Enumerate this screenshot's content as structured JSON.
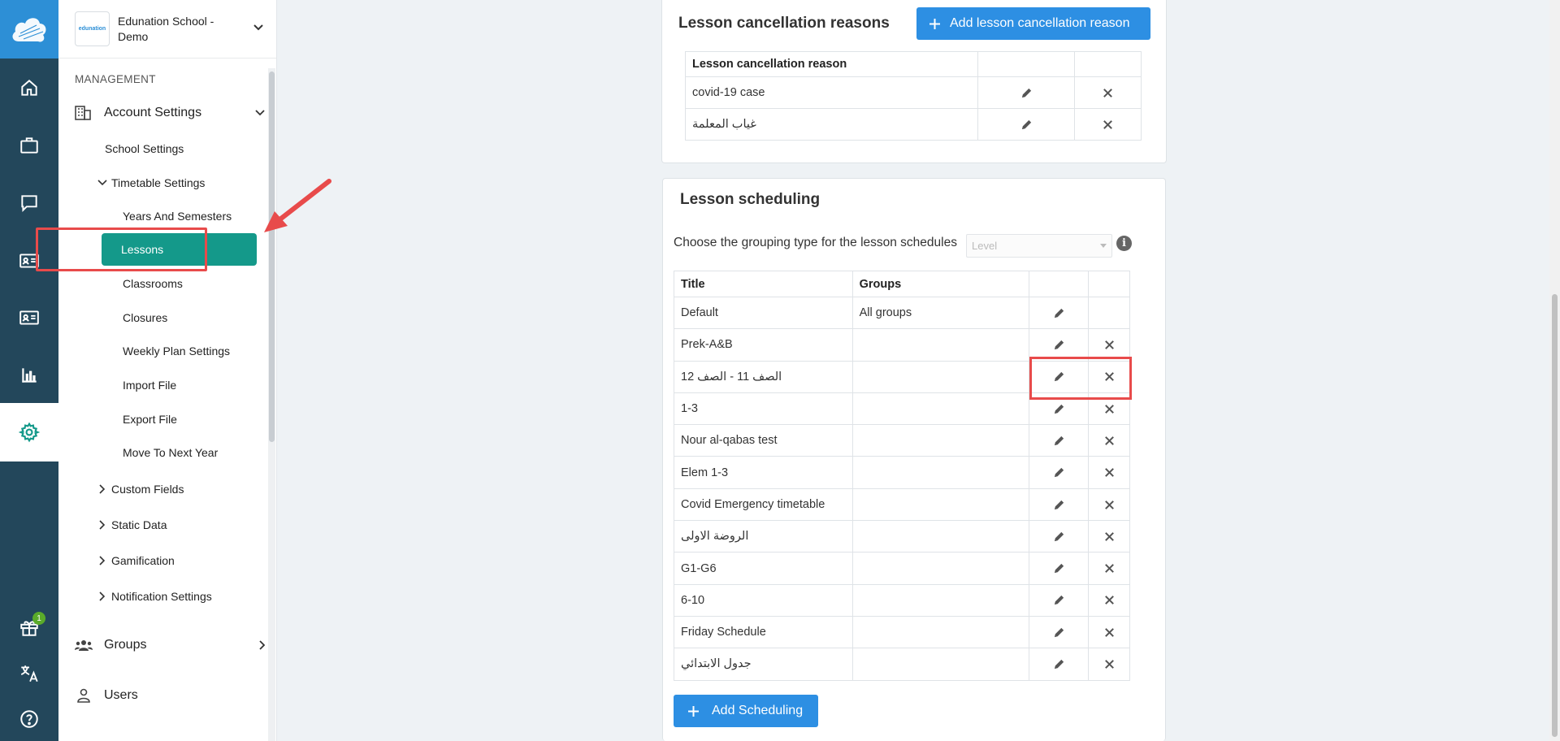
{
  "rail": {
    "items": [
      {
        "icon": "home-icon"
      },
      {
        "icon": "briefcase-icon"
      },
      {
        "icon": "chat-icon"
      },
      {
        "icon": "id-card-icon"
      },
      {
        "icon": "id-card-icon-2"
      },
      {
        "icon": "bar-chart-icon"
      },
      {
        "icon": "gear-icon"
      },
      {
        "icon": "gift-icon"
      },
      {
        "icon": "translate-icon"
      },
      {
        "icon": "help-icon"
      }
    ],
    "gift_badge": "1"
  },
  "sidebar": {
    "school_logo_text": "edunation",
    "school_name": "Edunation School - Demo",
    "section": "MANAGEMENT",
    "account_settings": "Account Settings",
    "school_settings": "School Settings",
    "timetable_settings": "Timetable Settings",
    "timetable_items": [
      "Years And Semesters",
      "Lessons",
      "Classrooms",
      "Closures",
      "Weekly Plan Settings",
      "Import File",
      "Export File",
      "Move To Next Year"
    ],
    "collapsed_items": [
      "Custom Fields",
      "Static Data",
      "Gamification",
      "Notification Settings"
    ],
    "groups": "Groups",
    "users": "Users"
  },
  "cancellation": {
    "title": "Lesson cancellation reasons",
    "add_button": "Add lesson cancellation reason",
    "header": "Lesson cancellation reason",
    "rows": [
      "covid-19 case",
      "غياب المعلمة"
    ]
  },
  "scheduling": {
    "title": "Lesson scheduling",
    "grouping_label": "Choose the grouping type for the lesson schedules",
    "grouping_value": "Level",
    "col_title": "Title",
    "col_groups": "Groups",
    "rows": [
      {
        "title": "Default",
        "groups": "All groups",
        "deletable": false
      },
      {
        "title": "Prek-A&B",
        "groups": "",
        "deletable": true
      },
      {
        "title": "الصف 11 - الصف 12",
        "groups": "",
        "deletable": true
      },
      {
        "title": "1-3",
        "groups": "",
        "deletable": true
      },
      {
        "title": "Nour al-qabas test",
        "groups": "",
        "deletable": true
      },
      {
        "title": "Elem 1-3",
        "groups": "",
        "deletable": true
      },
      {
        "title": "Covid Emergency timetable",
        "groups": "",
        "deletable": true
      },
      {
        "title": "الروضة الاولى",
        "groups": "",
        "deletable": true
      },
      {
        "title": "G1-G6",
        "groups": "",
        "deletable": true
      },
      {
        "title": "6-10",
        "groups": "",
        "deletable": true
      },
      {
        "title": "Friday Schedule",
        "groups": "",
        "deletable": true
      },
      {
        "title": "جدول الابتدائي",
        "groups": "",
        "deletable": true
      }
    ],
    "add_button": "Add Scheduling"
  },
  "colors": {
    "primary": "#2d8fe3",
    "teal": "#14998a",
    "rail": "#23475b",
    "highlight": "#e84b4b"
  }
}
